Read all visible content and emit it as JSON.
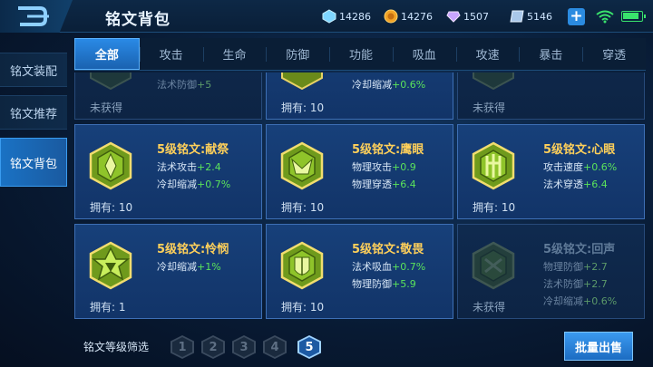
{
  "header": {
    "title": "铭文背包",
    "resources": [
      {
        "icon": "diamond-icon",
        "value": "14286"
      },
      {
        "icon": "gold-coin-icon",
        "value": "14276"
      },
      {
        "icon": "purple-crystal-icon",
        "value": "1507"
      },
      {
        "icon": "ticket-icon",
        "value": "5146"
      }
    ]
  },
  "sidebar": {
    "items": [
      {
        "label": "铭文装配"
      },
      {
        "label": "铭文推荐"
      },
      {
        "label": "铭文背包"
      }
    ]
  },
  "tabs": [
    "全部",
    "攻击",
    "生命",
    "防御",
    "功能",
    "吸血",
    "攻速",
    "暴击",
    "穿透"
  ],
  "cards_top": [
    {
      "stat": "法术防御",
      "value": "+5",
      "own": "未获得"
    },
    {
      "stat": "冷却缩减",
      "value": "+0.6%",
      "own": "拥有: 10"
    },
    {
      "own": "未获得"
    }
  ],
  "cards": [
    {
      "name": "5级铭文:献祭",
      "stats": [
        [
          "法术攻击",
          "+2.4"
        ],
        [
          "冷却缩减",
          "+0.7%"
        ]
      ],
      "own": "拥有: 10"
    },
    {
      "name": "5级铭文:鹰眼",
      "stats": [
        [
          "物理攻击",
          "+0.9"
        ],
        [
          "物理穿透",
          "+6.4"
        ]
      ],
      "own": "拥有: 10"
    },
    {
      "name": "5级铭文:心眼",
      "stats": [
        [
          "攻击速度",
          "+0.6%"
        ],
        [
          "法术穿透",
          "+6.4"
        ]
      ],
      "own": "拥有: 10"
    },
    {
      "name": "5级铭文:怜悯",
      "stats": [
        [
          "冷却缩减",
          "+1%"
        ]
      ],
      "own": "拥有: 1"
    },
    {
      "name": "5级铭文:敬畏",
      "stats": [
        [
          "法术吸血",
          "+0.7%"
        ],
        [
          "物理防御",
          "+5.9"
        ]
      ],
      "own": "拥有: 10"
    },
    {
      "name": "5级铭文:回声",
      "stats": [
        [
          "物理防御",
          "+2.7"
        ],
        [
          "法术防御",
          "+2.7"
        ],
        [
          "冷却缩减",
          "+0.6%"
        ]
      ],
      "own": "未获得"
    }
  ],
  "bottom": {
    "filter_label": "铭文等级筛选",
    "levels": [
      "1",
      "2",
      "3",
      "4",
      "5"
    ],
    "sell_label": "批量出售"
  },
  "colors": {
    "accent": "#2a8ae6",
    "stat_value": "#5be35b",
    "card_title": "#ffd05a"
  }
}
